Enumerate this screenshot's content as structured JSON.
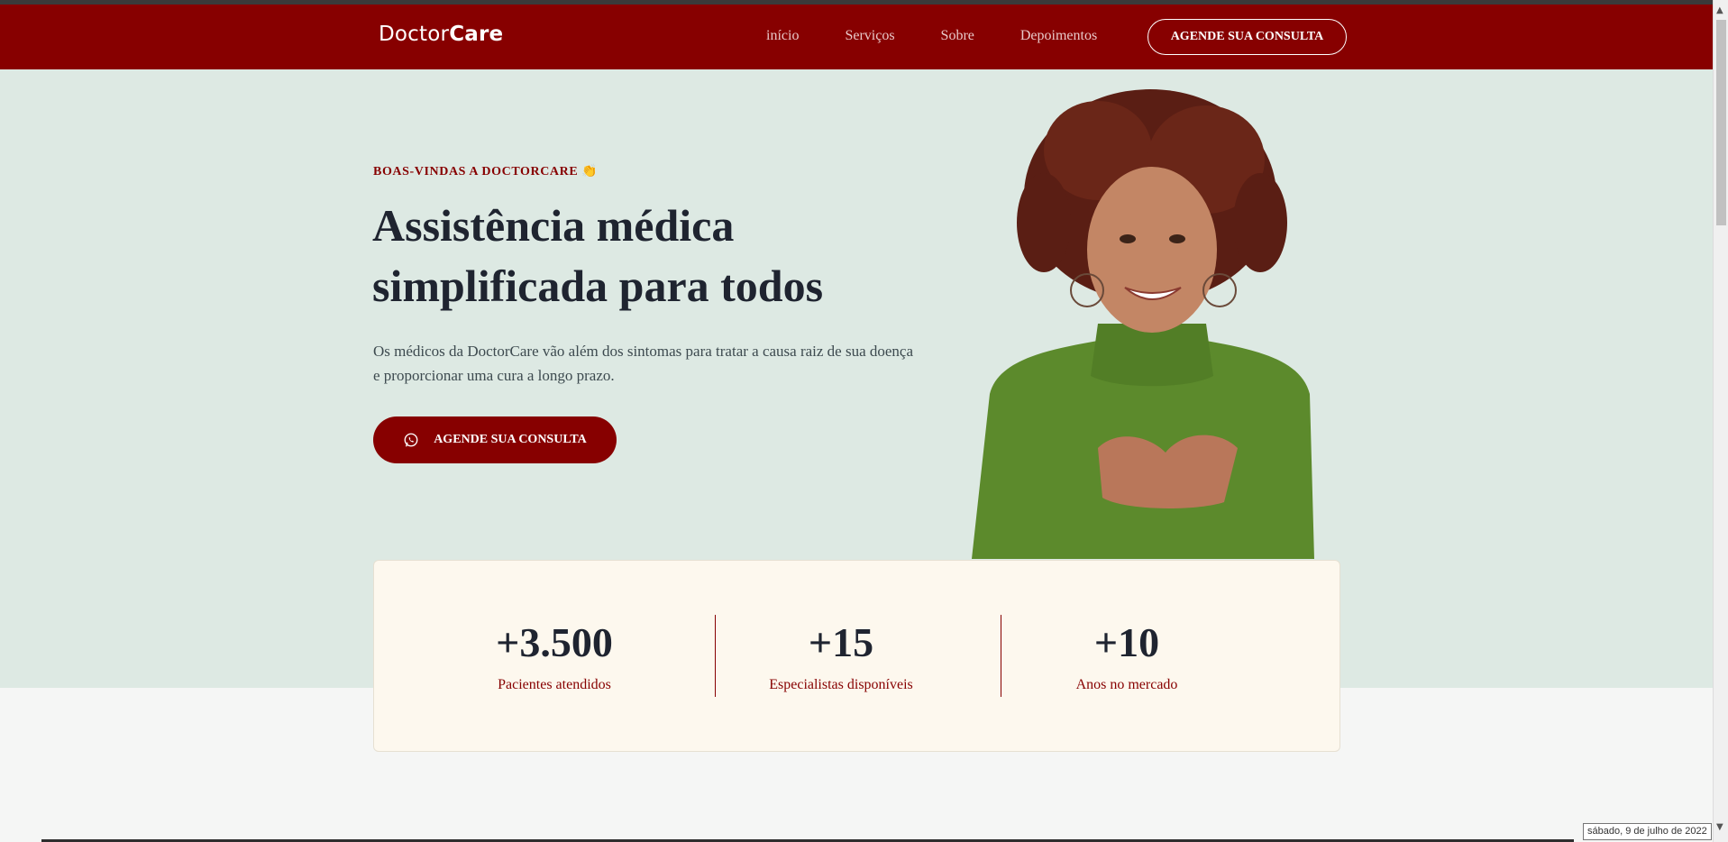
{
  "header": {
    "logo_part1": "Doctor",
    "logo_part2": "Care",
    "nav": [
      "início",
      "Serviços",
      "Sobre",
      "Depoimentos"
    ],
    "cta_label": "AGENDE SUA CONSULTA"
  },
  "hero": {
    "welcome": "BOAS-VINDAS A DOCTORCARE",
    "welcome_emoji": "👏",
    "title_line1": "Assistência médica",
    "title_line2": "simplificada para todos",
    "description": "Os médicos da DoctorCare vão além dos sintomas para tratar a causa raiz de sua doença e proporcionar uma cura a longo prazo.",
    "cta_label": "AGENDE SUA CONSULTA",
    "cta_icon": "whatsapp-icon"
  },
  "stats": [
    {
      "value": "+3.500",
      "label": "Pacientes atendidos"
    },
    {
      "value": "+15",
      "label": "Especialistas disponíveis"
    },
    {
      "value": "+10",
      "label": "Anos no mercado"
    }
  ],
  "system": {
    "date_tooltip": "sábado, 9 de julho de 2022"
  },
  "colors": {
    "brand": "#870000",
    "hero_bg": "#dde9e3",
    "stats_bg": "#fdf8ee",
    "heading": "#1f2430"
  }
}
